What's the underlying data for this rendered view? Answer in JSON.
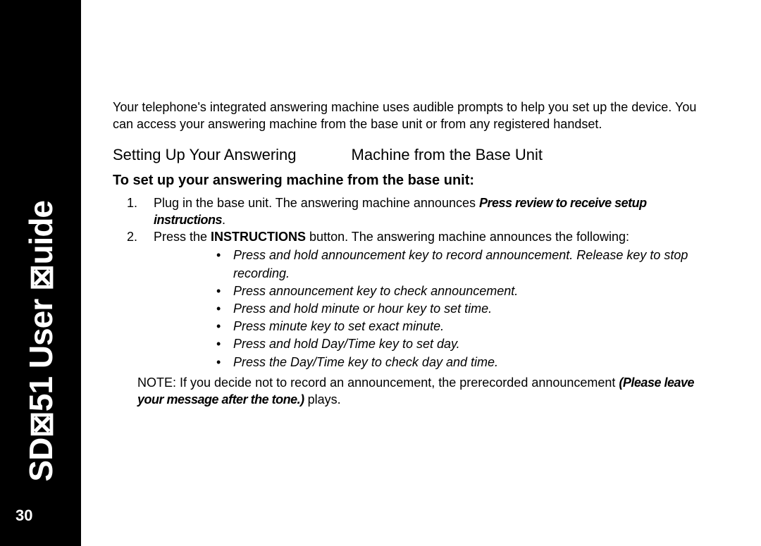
{
  "sidebar": {
    "title": "SD⊠51 User ⊠uide",
    "page_number": "30"
  },
  "intro": "Your telephone's integrated answering machine uses audible prompts to help you set up the device. You can access your answering machine from the base unit or from any registered handset.",
  "section_heading_a": "Setting Up Your Answering",
  "section_heading_b": "Machine from the Base Unit",
  "subheading": "To set up your answering machine from the base unit:",
  "steps": {
    "step1_a": "Plug in the base unit. The answering machine announces ",
    "step1_emph": "Press review to receive setup instructions",
    "step1_b": ".",
    "step2_a": "Press the ",
    "step2_strong": "INSTRUCTIONS",
    "step2_b": " button. The answering machine announces the following:"
  },
  "bullets": {
    "b0": "Press and hold announcement key to record announcement. Release key to stop recording.",
    "b1": "Press announcement key to check announcement.",
    "b2": "Press and hold minute or hour key to set time.",
    "b3": "Press minute key to set exact minute.",
    "b4": "Press and hold Day/Time key to set day.",
    "b5": "Press the Day/Time key to check day and time."
  },
  "note": {
    "a": "NOTE: If you decide not to record an announcement, the prerecorded announcement ",
    "emph": "(Please leave your message after the tone.)",
    "b": " plays."
  }
}
